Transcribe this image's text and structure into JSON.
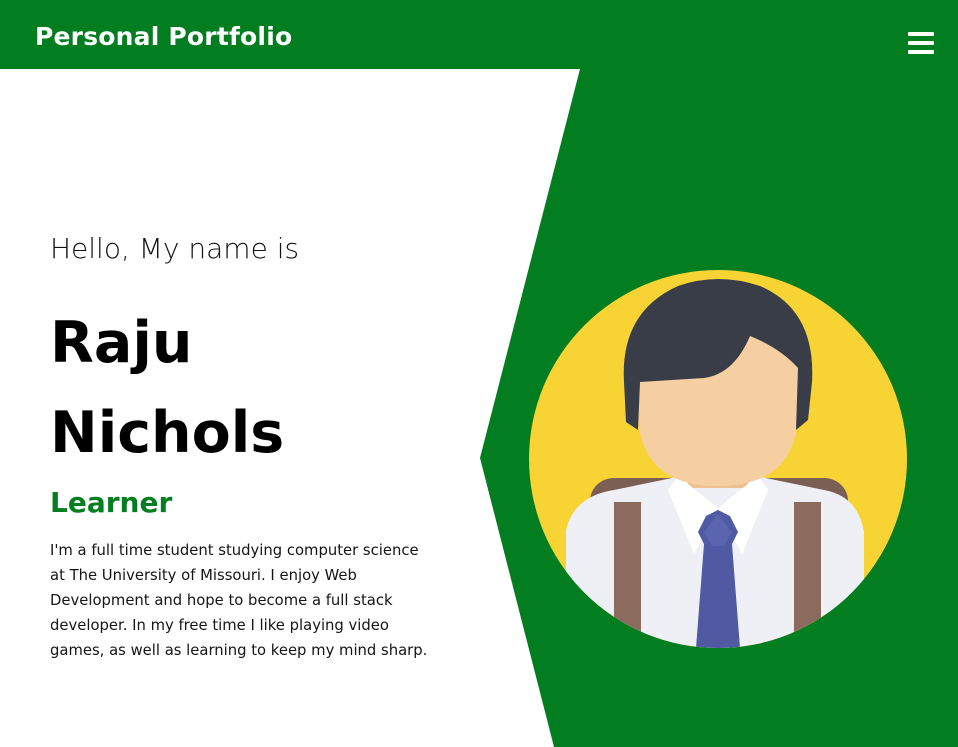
{
  "navbar": {
    "brand": "Personal Portfolio",
    "menu_icon": "hamburger-menu-icon",
    "background": "#027d20"
  },
  "hero": {
    "greeting": "Hello, My name is",
    "first_name": "Raju",
    "last_name": "Nichols",
    "role": "Learner",
    "bio": "I'm a full time student studying computer science at The University of Missouri. I enjoy Web Development and hope to become a full stack developer. In my free time I like playing video games, as well as learning to keep my mind sharp.",
    "avatar_icon": "student-avatar-illustration"
  },
  "colors": {
    "accent_green": "#027d20",
    "avatar_circle": "#f8d334",
    "hair": "#393d47",
    "skin": "#f5cfa1",
    "shirt": "#eef0f5",
    "tie": "#4f5aa3",
    "backpack_strap": "#8a6b5e"
  }
}
